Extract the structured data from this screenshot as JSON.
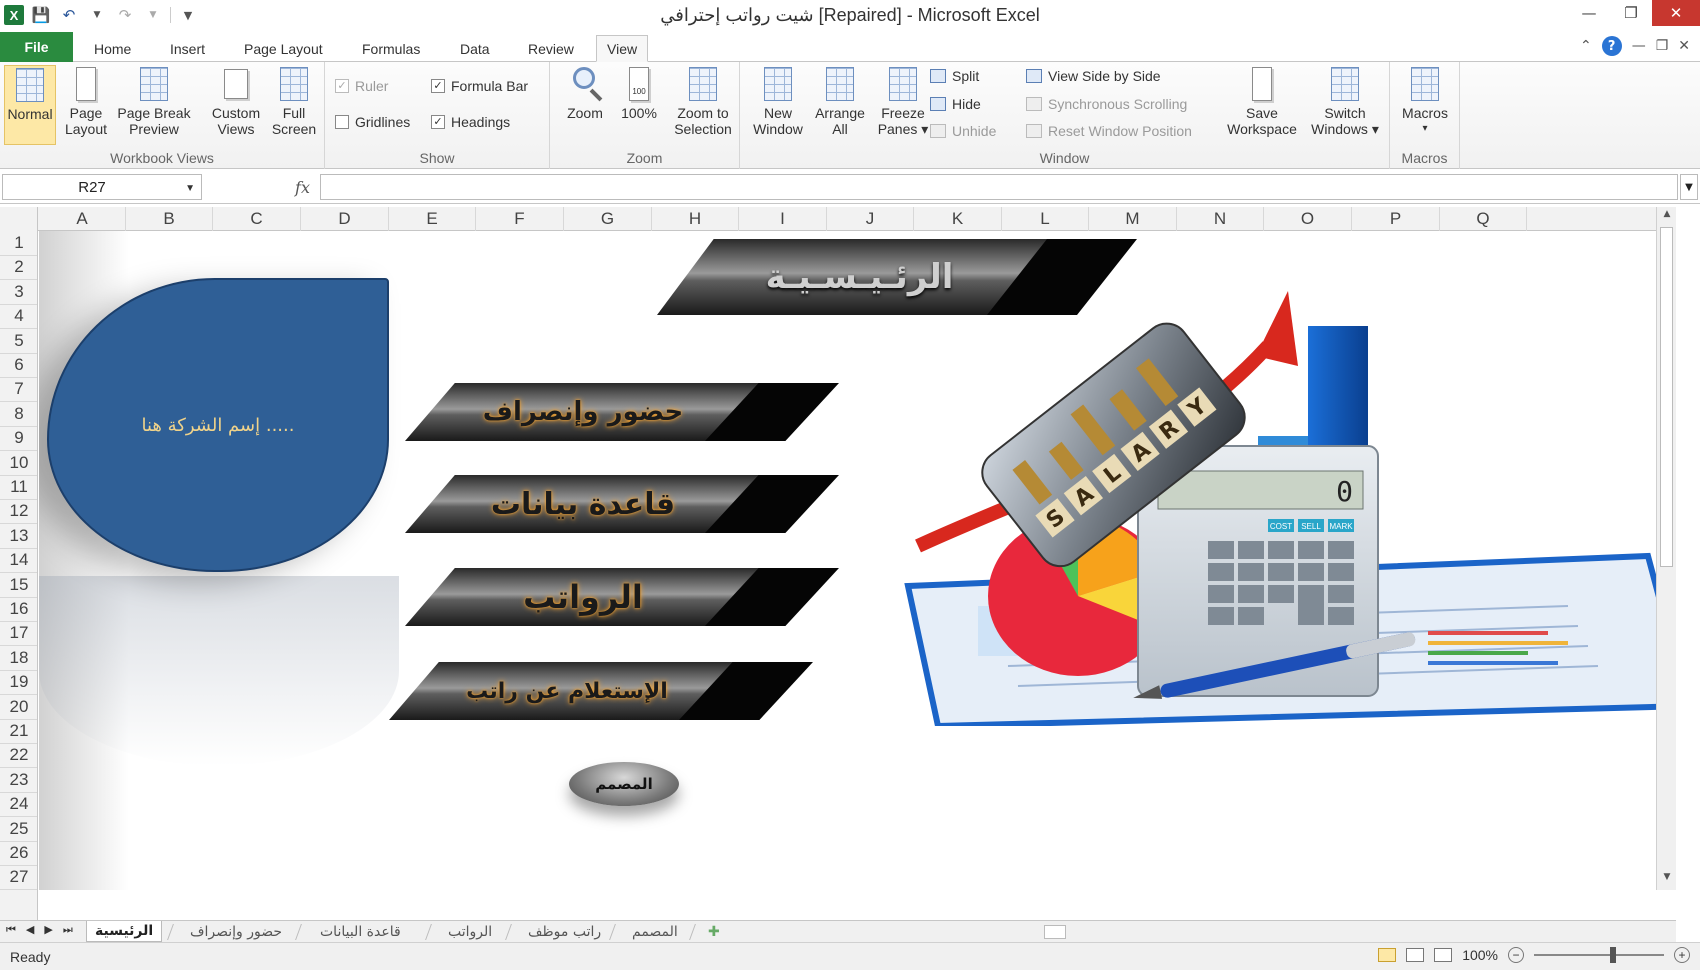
{
  "window": {
    "title": "شيت رواتب إحترافي [Repaired]  -  Microsoft Excel",
    "app_icon": "X"
  },
  "tabs": {
    "file": "File",
    "items": [
      "Home",
      "Insert",
      "Page Layout",
      "Formulas",
      "Data",
      "Review",
      "View"
    ],
    "active": "View"
  },
  "ribbon": {
    "workbook_views": {
      "label": "Workbook Views",
      "normal": "Normal",
      "page_layout": [
        "Page",
        "Layout"
      ],
      "page_break": [
        "Page Break",
        "Preview"
      ],
      "custom_views": [
        "Custom",
        "Views"
      ],
      "full_screen": [
        "Full",
        "Screen"
      ]
    },
    "show": {
      "label": "Show",
      "ruler": "Ruler",
      "formula_bar": "Formula Bar",
      "gridlines": "Gridlines",
      "headings": "Headings"
    },
    "zoom": {
      "label": "Zoom",
      "zoom": "Zoom",
      "hundred": "100%",
      "hundred_icon_text": "100",
      "zoom_to_selection": [
        "Zoom to",
        "Selection"
      ]
    },
    "window": {
      "label": "Window",
      "new_window": [
        "New",
        "Window"
      ],
      "arrange_all": [
        "Arrange",
        "All"
      ],
      "freeze_panes": [
        "Freeze",
        "Panes ▾"
      ],
      "split": "Split",
      "hide": "Hide",
      "unhide": "Unhide",
      "view_side_by_side": "View Side by Side",
      "sync_scrolling": "Synchronous Scrolling",
      "reset_window": "Reset Window Position",
      "save_workspace": [
        "Save",
        "Workspace"
      ],
      "switch_windows": [
        "Switch",
        "Windows ▾"
      ]
    },
    "macros": {
      "label": "Macros",
      "macros": "Macros",
      "dropdown": "▾"
    }
  },
  "formula_bar": {
    "name_box": "R27",
    "fx": "fx",
    "value": ""
  },
  "grid": {
    "columns": [
      "A",
      "B",
      "C",
      "D",
      "E",
      "F",
      "G",
      "H",
      "I",
      "J",
      "K",
      "L",
      "M",
      "N",
      "O",
      "P",
      "Q"
    ],
    "rows": [
      "1",
      "2",
      "3",
      "4",
      "5",
      "6",
      "7",
      "8",
      "9",
      "10",
      "11",
      "12",
      "13",
      "14",
      "15",
      "16",
      "17",
      "18",
      "19",
      "20",
      "21",
      "22",
      "23",
      "24",
      "25",
      "26",
      "27"
    ]
  },
  "sheet": {
    "company_placeholder": "إسم الشركة هنا .....",
    "main_title": "الرئـيـسـيـة",
    "buttons": [
      "حضور وإنصراف",
      "قاعدة بيانات",
      "الرواتب",
      "الإستعلام عن راتب"
    ],
    "designer": "المصمم",
    "salary_letters": [
      "S",
      "A",
      "L",
      "A",
      "R",
      "Y"
    ],
    "calculator_display": "0",
    "calc_labels": [
      "COST",
      "SELL",
      "MARK"
    ]
  },
  "sheet_tabs": {
    "items": [
      "الرئيسية",
      "حضور وإنصراف",
      "قاعدة البيانات",
      "الرواتب",
      "راتب موظف",
      "المصمم"
    ],
    "active": "الرئيسية"
  },
  "status": {
    "ready": "Ready",
    "zoom": "100%"
  },
  "colors": {
    "file_tab": "#2a8b3f",
    "company_shape": "#2f5f96",
    "company_text": "#f0d38a",
    "banner_glow": "#f0a030",
    "close_button": "#c7372f"
  }
}
